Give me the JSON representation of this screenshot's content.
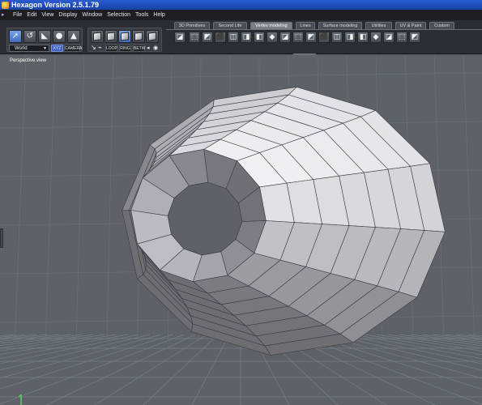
{
  "window": {
    "title": "Hexagon Version 2.5.1.79"
  },
  "menu": [
    "File",
    "Edit",
    "View",
    "Display",
    "Window",
    "Selection",
    "Tools",
    "Help"
  ],
  "selection_panel": {
    "coordinate_system": "World",
    "xyz_label": "XYZ",
    "camera_label": "CAMERA"
  },
  "modeling_panel": {
    "loop_label": "LOOP",
    "ring_label": "RING",
    "betw_label": "BETW"
  },
  "tabs": [
    {
      "label": "3D Primitives",
      "active": false
    },
    {
      "label": "Second Life",
      "active": false
    },
    {
      "label": "Vertex modeling",
      "active": true
    },
    {
      "label": "Lines",
      "active": false
    },
    {
      "label": "Surface modeling",
      "active": false
    },
    {
      "label": "Utilities",
      "active": false
    },
    {
      "label": "UV & Paint",
      "active": false
    },
    {
      "label": "Custom",
      "active": false
    }
  ],
  "viewport": {
    "label": "Perspective.view",
    "background_color": "#5e6167",
    "grid_color": "#6b6f76",
    "model_light": "#f2f2f4",
    "model_mid": "#c9cacf",
    "model_dark": "#8f9198"
  },
  "colors": {
    "titlebar": "#2a5ccf",
    "menubar": "#1d1d22",
    "active_tab": "#7a7e87",
    "accent": "#3f63c4"
  },
  "icons": [
    "hexagon-app-icon",
    "select-arrow-icon",
    "lasso-icon",
    "paint-select-icon",
    "sphere-select-icon",
    "magnet-icon",
    "cube-vertex-icon",
    "cube-edge-icon",
    "cube-face-icon",
    "cube-object-icon",
    "cube-auto-icon",
    "tweak-icon",
    "extrude-icon",
    "bevel-icon",
    "weld-icon",
    "tessellate-icon",
    "bridge-icon",
    "symmetry-icon",
    "hole-icon"
  ]
}
